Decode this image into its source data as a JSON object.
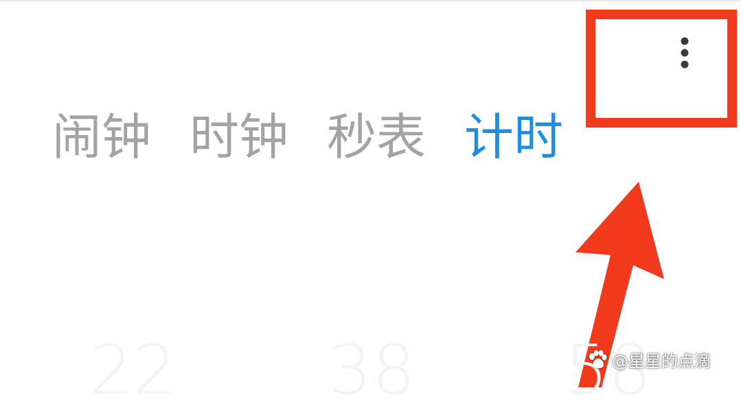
{
  "tabs": [
    {
      "label": "闹钟",
      "active": false
    },
    {
      "label": "时钟",
      "active": false
    },
    {
      "label": "秒表",
      "active": false
    },
    {
      "label": "计时",
      "active": true
    }
  ],
  "timer": {
    "hours": "22",
    "minutes": "38",
    "seconds": "58"
  },
  "menu": {
    "icon": "more-vertical-icon"
  },
  "annotation": {
    "highlight_color": "#f1391c",
    "arrow_color": "#f1391c"
  },
  "watermark": {
    "text": "@星星的点滴",
    "icon": "baidu-paw-icon"
  },
  "colors": {
    "active_tab": "#1f8de0",
    "inactive_tab": "#a3a3a3",
    "background": "#ffffff"
  }
}
